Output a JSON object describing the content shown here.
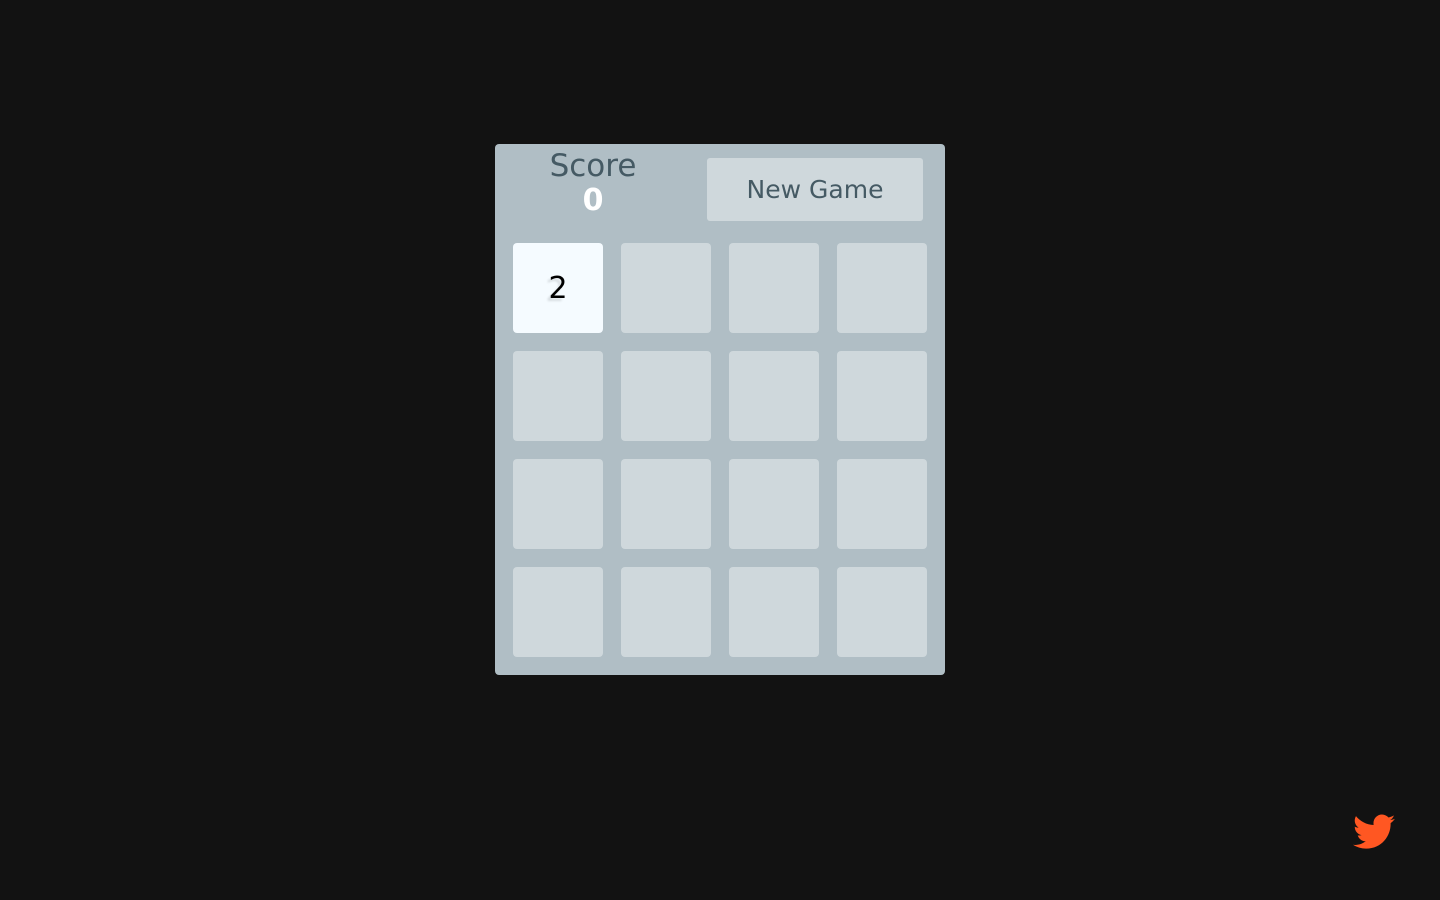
{
  "header": {
    "score_label": "Score",
    "score_value": "0",
    "new_game_label": "New Game"
  },
  "grid": {
    "rows": 4,
    "cols": 4,
    "cells": [
      [
        "2",
        "",
        "",
        ""
      ],
      [
        "",
        "",
        "",
        ""
      ],
      [
        "",
        "",
        "",
        ""
      ],
      [
        "",
        "",
        "",
        ""
      ]
    ]
  },
  "footer": {
    "share_icon": "twitter-icon",
    "accent_color": "#ff5722"
  },
  "colors": {
    "background": "#121212",
    "board": "#b0bec5",
    "empty_tile": "#cfd8dc",
    "tile_2": "#f5fbff",
    "text": "#455a64"
  }
}
